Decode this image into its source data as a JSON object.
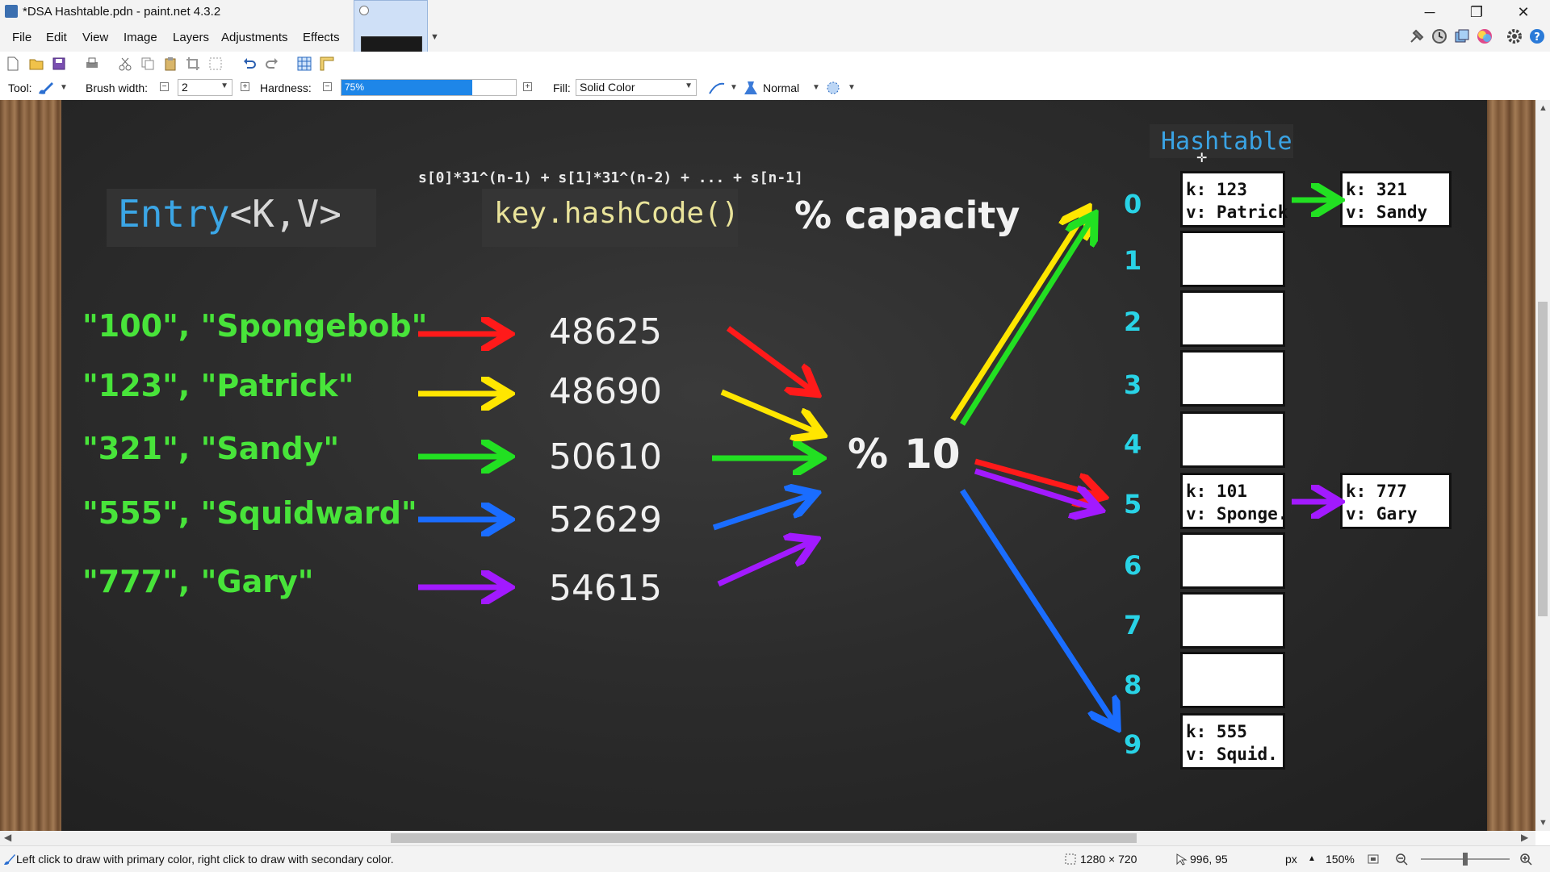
{
  "window": {
    "title": "*DSA Hashtable.pdn - paint.net 4.3.2",
    "minimize": "─",
    "maximize": "❐",
    "close": "✕"
  },
  "menu": [
    "File",
    "Edit",
    "View",
    "Image",
    "Layers",
    "Adjustments",
    "Effects"
  ],
  "toolbar": {
    "tool_label": "Tool:",
    "brush_width_label": "Brush width:",
    "brush_width_value": "2",
    "hardness_label": "Hardness:",
    "hardness_value": "75%",
    "hardness_percent": 75,
    "fill_label": "Fill:",
    "fill_value": "Solid Color",
    "blend_mode": "Normal"
  },
  "canvas": {
    "formula": "s[0]*31^(n-1) + s[1]*31^(n-2) + ... + s[n-1]",
    "entry_type": {
      "name": "Entry",
      "generics": "<K,V>"
    },
    "hash_call": "key.hashCode()",
    "capacity_label": "% capacity",
    "mod_label": "%",
    "mod_value": "10",
    "hashtable_title": "Hashtable",
    "rows": [
      {
        "pair": "\"100\", \"Spongebob\"",
        "hash": "48625",
        "color": "#ff1a1a"
      },
      {
        "pair": "\"123\", \"Patrick\"",
        "hash": "48690",
        "color": "#ffe600"
      },
      {
        "pair": "\"321\", \"Sandy\"",
        "hash": "50610",
        "color": "#22e022"
      },
      {
        "pair": "\"555\", \"Squidward\"",
        "hash": "52629",
        "color": "#1a6dff"
      },
      {
        "pair": "\"777\", \"Gary\"",
        "hash": "54615",
        "color": "#a21aff"
      }
    ],
    "indices": [
      "0",
      "1",
      "2",
      "3",
      "4",
      "5",
      "6",
      "7",
      "8",
      "9"
    ],
    "buckets": [
      {
        "k": "k: 123",
        "v": "v: Patrick"
      },
      {
        "k": "",
        "v": ""
      },
      {
        "k": "",
        "v": ""
      },
      {
        "k": "",
        "v": ""
      },
      {
        "k": "",
        "v": ""
      },
      {
        "k": "k: 101",
        "v": "v: Sponge."
      },
      {
        "k": "",
        "v": ""
      },
      {
        "k": "",
        "v": ""
      },
      {
        "k": "",
        "v": ""
      },
      {
        "k": "k: 555",
        "v": "v: Squid."
      }
    ],
    "chain_nodes": [
      {
        "k": "k: 321",
        "v": "v: Sandy"
      },
      {
        "k": "k: 777",
        "v": "v: Gary"
      }
    ],
    "colors": {
      "entry_name": "#3ba6e6",
      "entry_generics": "#d8d8d8",
      "index": "#29d3e6"
    }
  },
  "status": {
    "hint": "Left click to draw with primary color, right click to draw with secondary color.",
    "image_size": "1280 × 720",
    "cursor_position": "996, 95",
    "unit": "px",
    "zoom": "150%"
  }
}
